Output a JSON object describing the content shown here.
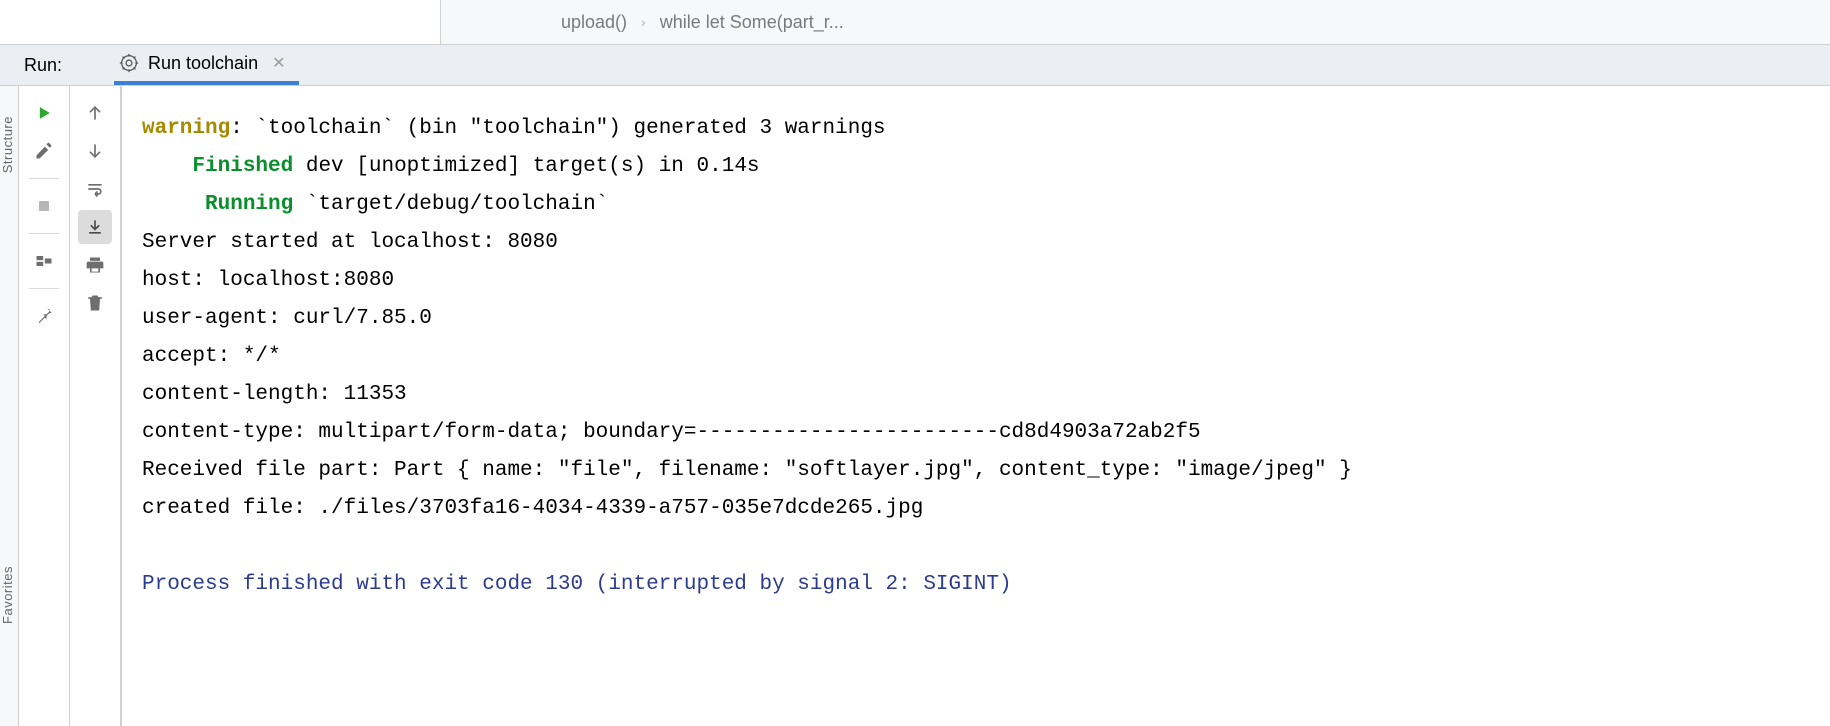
{
  "breadcrumb": {
    "item1": "upload()",
    "item2": "while let Some(part_r..."
  },
  "runStrip": {
    "label": "Run:",
    "tabLabel": "Run toolchain"
  },
  "leftEdge": {
    "top": "Structure",
    "bottom": "Favorites"
  },
  "console": {
    "warn_prefix": "warning",
    "warn_rest": ": `toolchain` (bin \"toolchain\") generated 3 warnings",
    "finished_indent": "    ",
    "finished_word": "Finished",
    "finished_rest": " dev [unoptimized] target(s) in 0.14s",
    "running_indent": "     ",
    "running_word": "Running",
    "running_rest": " `target/debug/toolchain`",
    "l4": "Server started at localhost: 8080",
    "l5": "host: localhost:8080",
    "l6": "user-agent: curl/7.85.0",
    "l7": "accept: */*",
    "l8": "content-length: 11353",
    "l9": "content-type: multipart/form-data; boundary=------------------------cd8d4903a72ab2f5",
    "l10": "Received file part: Part { name: \"file\", filename: \"softlayer.jpg\", content_type: \"image/jpeg\" }",
    "l11": "created file: ./files/3703fa16-4034-4339-a757-035e7dcde265.jpg",
    "blank": "",
    "exit": "Process finished with exit code 130 (interrupted by signal 2: SIGINT)"
  }
}
